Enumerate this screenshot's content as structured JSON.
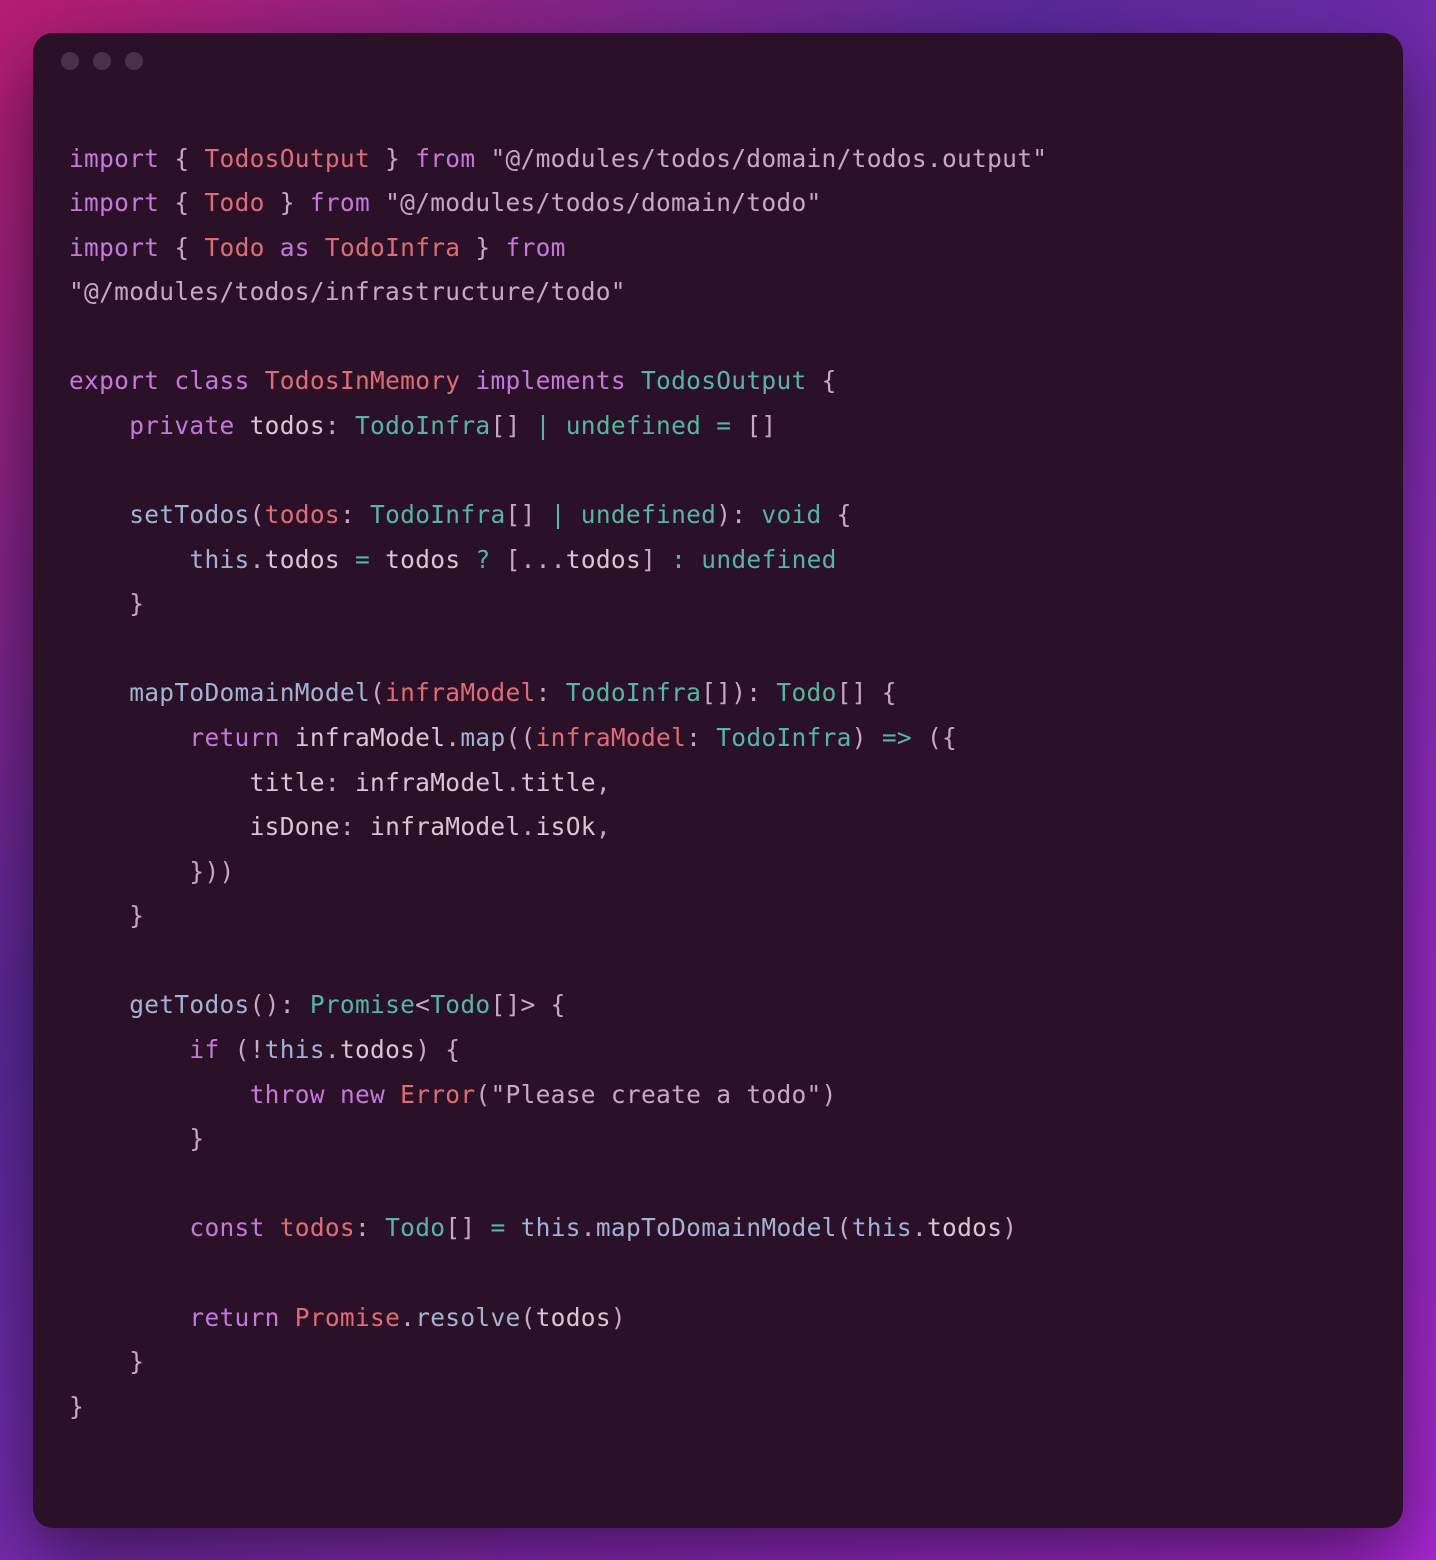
{
  "code": {
    "tokens": [
      [
        [
          "import",
          "kw"
        ],
        [
          " { ",
          "pn"
        ],
        [
          "TodosOutput",
          "ty"
        ],
        [
          " } ",
          "pn"
        ],
        [
          "from",
          "kw"
        ],
        [
          " ",
          "pn"
        ],
        [
          "\"@/modules/todos/domain/todos.output\"",
          "str"
        ]
      ],
      [
        [
          "import",
          "kw"
        ],
        [
          " { ",
          "pn"
        ],
        [
          "Todo",
          "ty"
        ],
        [
          " } ",
          "pn"
        ],
        [
          "from",
          "kw"
        ],
        [
          " ",
          "pn"
        ],
        [
          "\"@/modules/todos/domain/todo\"",
          "str"
        ]
      ],
      [
        [
          "import",
          "kw"
        ],
        [
          " { ",
          "pn"
        ],
        [
          "Todo",
          "ty"
        ],
        [
          " ",
          "pn"
        ],
        [
          "as",
          "kw"
        ],
        [
          " ",
          "pn"
        ],
        [
          "TodoInfra",
          "ty"
        ],
        [
          " } ",
          "pn"
        ],
        [
          "from",
          "kw"
        ]
      ],
      [
        [
          "\"@/modules/todos/infrastructure/todo\"",
          "str"
        ]
      ],
      [],
      [
        [
          "export",
          "kw"
        ],
        [
          " ",
          "pn"
        ],
        [
          "class",
          "kw"
        ],
        [
          " ",
          "pn"
        ],
        [
          "TodosInMemory",
          "ty"
        ],
        [
          " ",
          "pn"
        ],
        [
          "implements",
          "kw"
        ],
        [
          " ",
          "pn"
        ],
        [
          "TodosOutput",
          "ty2"
        ],
        [
          " {",
          "pn"
        ]
      ],
      [
        [
          "    ",
          "pn"
        ],
        [
          "private",
          "kw"
        ],
        [
          " ",
          "pn"
        ],
        [
          "todos",
          "prop"
        ],
        [
          ": ",
          "pn"
        ],
        [
          "TodoInfra",
          "ty2"
        ],
        [
          "[] ",
          "pn"
        ],
        [
          "|",
          "op"
        ],
        [
          " ",
          "pn"
        ],
        [
          "undefined",
          "und"
        ],
        [
          " ",
          "pn"
        ],
        [
          "=",
          "op"
        ],
        [
          " []",
          "pn"
        ]
      ],
      [],
      [
        [
          "    ",
          "pn"
        ],
        [
          "setTodos",
          "fn"
        ],
        [
          "(",
          "pn"
        ],
        [
          "todos",
          "ty"
        ],
        [
          ": ",
          "pn"
        ],
        [
          "TodoInfra",
          "ty2"
        ],
        [
          "[] ",
          "pn"
        ],
        [
          "|",
          "op"
        ],
        [
          " ",
          "pn"
        ],
        [
          "undefined",
          "und"
        ],
        [
          "): ",
          "pn"
        ],
        [
          "void",
          "und"
        ],
        [
          " {",
          "pn"
        ]
      ],
      [
        [
          "        ",
          "pn"
        ],
        [
          "this",
          "var"
        ],
        [
          ".",
          "pn"
        ],
        [
          "todos",
          "prop"
        ],
        [
          " ",
          "pn"
        ],
        [
          "=",
          "op"
        ],
        [
          " ",
          "pn"
        ],
        [
          "todos",
          "prop"
        ],
        [
          " ",
          "pn"
        ],
        [
          "?",
          "op"
        ],
        [
          " [...",
          "pn"
        ],
        [
          "todos",
          "prop"
        ],
        [
          "] ",
          "pn"
        ],
        [
          ":",
          "op"
        ],
        [
          " ",
          "pn"
        ],
        [
          "undefined",
          "und"
        ]
      ],
      [
        [
          "    }",
          "pn"
        ]
      ],
      [],
      [
        [
          "    ",
          "pn"
        ],
        [
          "mapToDomainModel",
          "fn"
        ],
        [
          "(",
          "pn"
        ],
        [
          "infraModel",
          "ty"
        ],
        [
          ": ",
          "pn"
        ],
        [
          "TodoInfra",
          "ty2"
        ],
        [
          "[]): ",
          "pn"
        ],
        [
          "Todo",
          "ty2"
        ],
        [
          "[] {",
          "pn"
        ]
      ],
      [
        [
          "        ",
          "pn"
        ],
        [
          "return",
          "kw"
        ],
        [
          " ",
          "pn"
        ],
        [
          "infraModel",
          "prop"
        ],
        [
          ".",
          "pn"
        ],
        [
          "map",
          "fn"
        ],
        [
          "((",
          "pn"
        ],
        [
          "infraModel",
          "ty"
        ],
        [
          ": ",
          "pn"
        ],
        [
          "TodoInfra",
          "ty2"
        ],
        [
          ") ",
          "pn"
        ],
        [
          "=>",
          "op"
        ],
        [
          " ({",
          "pn"
        ]
      ],
      [
        [
          "            ",
          "pn"
        ],
        [
          "title",
          "prop"
        ],
        [
          ": ",
          "pn"
        ],
        [
          "infraModel",
          "prop"
        ],
        [
          ".",
          "pn"
        ],
        [
          "title",
          "prop"
        ],
        [
          ",",
          "pn"
        ]
      ],
      [
        [
          "            ",
          "pn"
        ],
        [
          "isDone",
          "prop"
        ],
        [
          ": ",
          "pn"
        ],
        [
          "infraModel",
          "prop"
        ],
        [
          ".",
          "pn"
        ],
        [
          "isOk",
          "prop"
        ],
        [
          ",",
          "pn"
        ]
      ],
      [
        [
          "        }))",
          "pn"
        ]
      ],
      [
        [
          "    }",
          "pn"
        ]
      ],
      [],
      [
        [
          "    ",
          "pn"
        ],
        [
          "getTodos",
          "fn"
        ],
        [
          "(): ",
          "pn"
        ],
        [
          "Promise",
          "ty2"
        ],
        [
          "<",
          "pn"
        ],
        [
          "Todo",
          "ty2"
        ],
        [
          "[]> {",
          "pn"
        ]
      ],
      [
        [
          "        ",
          "pn"
        ],
        [
          "if",
          "kw"
        ],
        [
          " (!",
          "pn"
        ],
        [
          "this",
          "var"
        ],
        [
          ".",
          "pn"
        ],
        [
          "todos",
          "prop"
        ],
        [
          ") {",
          "pn"
        ]
      ],
      [
        [
          "            ",
          "pn"
        ],
        [
          "throw",
          "kw"
        ],
        [
          " ",
          "pn"
        ],
        [
          "new",
          "kw"
        ],
        [
          " ",
          "pn"
        ],
        [
          "Error",
          "ty"
        ],
        [
          "(",
          "pn"
        ],
        [
          "\"Please create a todo\"",
          "str"
        ],
        [
          ")",
          "pn"
        ]
      ],
      [
        [
          "        }",
          "pn"
        ]
      ],
      [],
      [
        [
          "        ",
          "pn"
        ],
        [
          "const",
          "kw"
        ],
        [
          " ",
          "pn"
        ],
        [
          "todos",
          "ty"
        ],
        [
          ": ",
          "pn"
        ],
        [
          "Todo",
          "ty2"
        ],
        [
          "[] ",
          "pn"
        ],
        [
          "=",
          "op"
        ],
        [
          " ",
          "pn"
        ],
        [
          "this",
          "var"
        ],
        [
          ".",
          "pn"
        ],
        [
          "mapToDomainModel",
          "fn"
        ],
        [
          "(",
          "pn"
        ],
        [
          "this",
          "var"
        ],
        [
          ".",
          "pn"
        ],
        [
          "todos",
          "prop"
        ],
        [
          ")",
          "pn"
        ]
      ],
      [],
      [
        [
          "        ",
          "pn"
        ],
        [
          "return",
          "kw"
        ],
        [
          " ",
          "pn"
        ],
        [
          "Promise",
          "ty"
        ],
        [
          ".",
          "pn"
        ],
        [
          "resolve",
          "fn"
        ],
        [
          "(",
          "pn"
        ],
        [
          "todos",
          "prop"
        ],
        [
          ")",
          "pn"
        ]
      ],
      [
        [
          "    }",
          "pn"
        ]
      ],
      [
        [
          "}",
          "pn"
        ]
      ]
    ]
  }
}
